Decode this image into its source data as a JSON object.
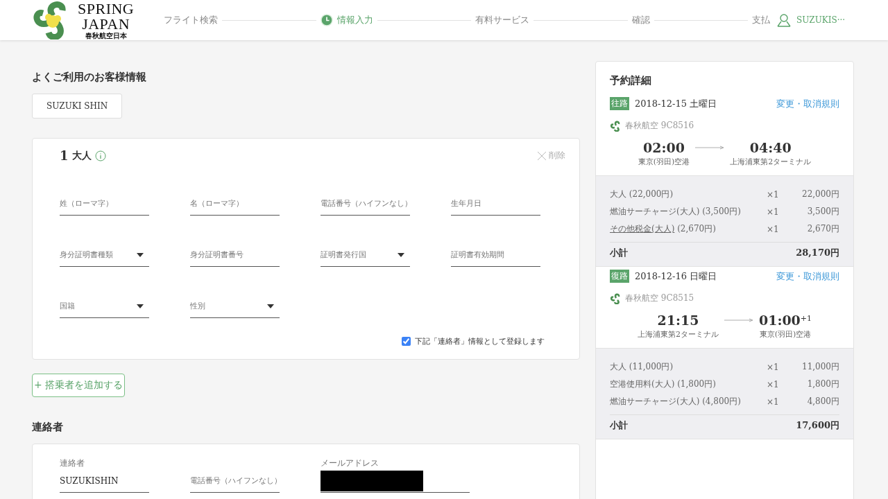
{
  "header": {
    "logo": {
      "line1": "SPRING",
      "line2": "JAPAN",
      "subtitle": "春秋航空日本"
    },
    "steps": [
      {
        "label": "フライト検索",
        "selected": false
      },
      {
        "label": "情報入力",
        "selected": true
      },
      {
        "label": "有料サービス",
        "selected": false
      },
      {
        "label": "確認",
        "selected": false
      },
      {
        "label": "支払",
        "selected": false
      }
    ],
    "user": "SUZUKIS···"
  },
  "frequent": {
    "title": "よくご利用のお客様情報",
    "chips": [
      "SUZUKI SHIN"
    ]
  },
  "passenger": {
    "number": "1",
    "type": "大人",
    "delete": "削除",
    "fields": [
      {
        "kind": "text",
        "placeholder": "姓（ローマ字）"
      },
      {
        "kind": "text",
        "placeholder": "名（ローマ字）"
      },
      {
        "kind": "text",
        "placeholder": "電話番号（ハイフンなし）"
      },
      {
        "kind": "text",
        "placeholder": "生年月日"
      },
      {
        "kind": "select",
        "placeholder": "身分証明書種類"
      },
      {
        "kind": "text",
        "placeholder": "身分証明書番号"
      },
      {
        "kind": "select",
        "placeholder": "証明書発行国"
      },
      {
        "kind": "text",
        "placeholder": "証明書有効期間"
      },
      {
        "kind": "select",
        "placeholder": "国籍"
      },
      {
        "kind": "select",
        "placeholder": "性別"
      }
    ],
    "register_contact": {
      "label": "下記「連絡者」情報として登録します",
      "checked": true
    }
  },
  "add_passenger": "+ 搭乗者を追加する",
  "contact": {
    "title": "連絡者",
    "fields": [
      {
        "kind": "labeled",
        "label": "連絡者",
        "value": "SUZUKISHIN"
      },
      {
        "kind": "text",
        "placeholder": "電話番号（ハイフンなし）"
      },
      {
        "kind": "redacted",
        "label": "メールアドレス"
      }
    ]
  },
  "booking": {
    "title": "予約詳細",
    "segments": [
      {
        "tag": "往路",
        "date": "2018-12-15 土曜日",
        "link": "変更・取消規則",
        "flight": "春秋航空 9C8516",
        "depart_time": "02:00",
        "arrive_time": "04:40",
        "from": "東京(羽田)空港",
        "to": "上海浦東第2ターミナル",
        "fees": [
          {
            "name": "大人 (22,000円)",
            "underlined": false,
            "qty": "×1",
            "amount": "22,000円"
          },
          {
            "name": "燃油サーチャージ(大人) (3,500円)",
            "underlined": false,
            "qty": "×1",
            "amount": "3,500円"
          },
          {
            "name": "その他税金(大人)",
            "underlined": true,
            "extra": " (2,670円)",
            "qty": "×1",
            "amount": "2,670円"
          }
        ],
        "subtotal_label": "小計",
        "subtotal": "28,170円"
      },
      {
        "tag": "復路",
        "date": "2018-12-16 日曜日",
        "link": "変更・取消規則",
        "flight": "春秋航空 9C8515",
        "depart_time": "21:15",
        "arrive_time": "01:00",
        "day_offset": "+1",
        "from": "上海浦東第2ターミナル",
        "to": "東京(羽田)空港",
        "fees": [
          {
            "name": "大人 (11,000円)",
            "underlined": false,
            "qty": "×1",
            "amount": "11,000円"
          },
          {
            "name": "空港使用料(大人) (1,800円)",
            "underlined": false,
            "qty": "×1",
            "amount": "1,800円"
          },
          {
            "name": "燃油サーチャージ(大人) (4,800円)",
            "underlined": false,
            "qty": "×1",
            "amount": "4,800円"
          }
        ],
        "subtotal_label": "小計",
        "subtotal": "17,600円"
      }
    ]
  }
}
